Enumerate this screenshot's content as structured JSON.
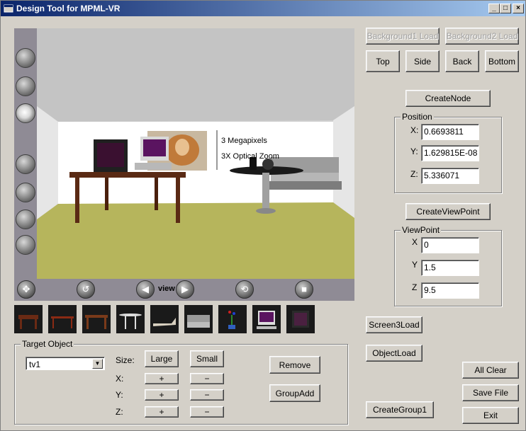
{
  "window": {
    "title": "Design Tool for MPML-VR"
  },
  "title_buttons": {
    "minimize": "_",
    "maximize": "□",
    "close": "×"
  },
  "top_buttons": {
    "bg1": "Background1 Load",
    "bg2": "Background2 Load"
  },
  "view_buttons": {
    "top": "Top",
    "side": "Side",
    "back": "Back",
    "bottom": "Bottom"
  },
  "create_node": "CreateNode",
  "position": {
    "legend": "Position",
    "x_label": "X:",
    "x_value": "0.6693811",
    "y_label": "Y:",
    "y_value": "1.629815E-08",
    "z_label": "Z:",
    "z_value": "5.336071"
  },
  "create_viewpoint": "CreateViewPoint",
  "viewpoint": {
    "legend": "ViewPoint",
    "x_label": "X",
    "x_value": "0",
    "y_label": "Y",
    "y_value": "1.5",
    "z_label": "Z",
    "z_value": "9.5"
  },
  "scene": {
    "poster_line1": "3 Megapixels",
    "poster_line2": "3X Optical Zoom",
    "nav_label": "view"
  },
  "screen3_load": "Screen3Load",
  "object_load": "ObjectLoad",
  "create_group": "CreateGroup1",
  "all_clear": "All Clear",
  "save_file": "Save File",
  "exit": "Exit",
  "target": {
    "legend": "Target Object",
    "selected": "tv1",
    "size_label": "Size:",
    "large": "Large",
    "small": "Small",
    "x_label": "X:",
    "y_label": "Y:",
    "z_label": "Z:",
    "plus": "+",
    "minus": "−",
    "remove": "Remove",
    "group_add": "GroupAdd"
  },
  "thumbnails": [
    "table-dark",
    "table-red",
    "table-brown",
    "table-round",
    "sofa-lounge",
    "sofa",
    "vase-flowers",
    "computer-monitor",
    "tv"
  ],
  "colors": {
    "titlebar": "#0a246a",
    "face": "#d4d0c8",
    "floor": "#b8b860",
    "wall": "#ffffff"
  }
}
